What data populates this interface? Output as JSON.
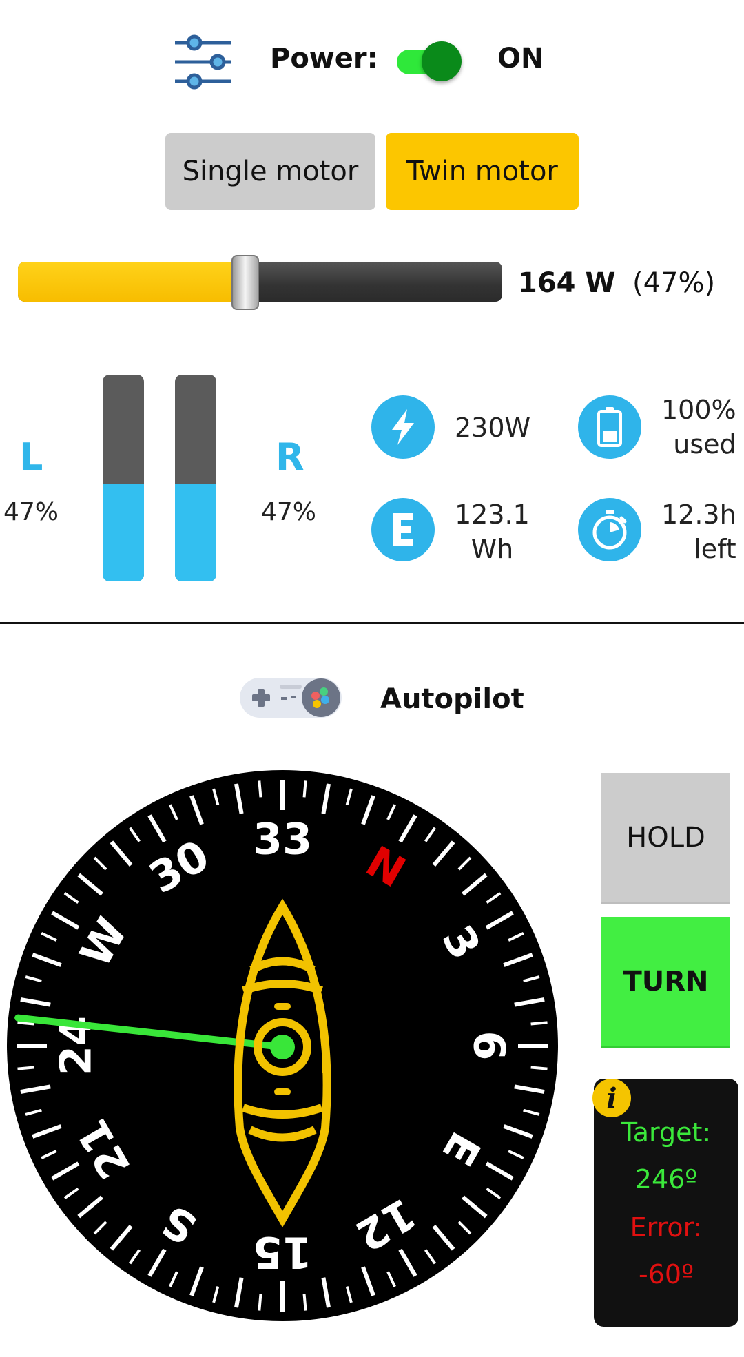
{
  "header": {
    "power_label": "Power:",
    "power_state": "ON",
    "power_on": true
  },
  "modes": {
    "single_label": "Single motor",
    "twin_label": "Twin motor",
    "selected": "Twin motor",
    "selected_color": "#fcc600"
  },
  "power_slider": {
    "level": 0.47,
    "watts_text": "164 W",
    "percent_text": "(47%)",
    "fill_color": "#f7bd00"
  },
  "motors": {
    "left_label": "L",
    "left_pct": "47%",
    "left_level": 0.47,
    "right_label": "R",
    "right_pct": "47%",
    "right_level": 0.47,
    "bar_color": "#33bff0"
  },
  "stats": {
    "power_value": "230W",
    "power_icon": "lightning-icon",
    "battery_line1": "100%",
    "battery_line2": "used",
    "battery_icon": "battery-icon",
    "energy_line1": "123.1",
    "energy_line2": "Wh",
    "energy_icon": "energy-e-icon",
    "time_line1": "12.3h",
    "time_line2": "left",
    "time_icon": "stopwatch-icon"
  },
  "autopilot": {
    "label": "Autopilot",
    "icon": "gamepad-icon"
  },
  "compass": {
    "cardinal_labels": [
      "N",
      "E",
      "S",
      "W"
    ],
    "degree_labels": [
      "3",
      "6",
      "12",
      "15",
      "21",
      "24",
      "30",
      "33"
    ],
    "rotation_deg": 30,
    "target_heading_deg": 246,
    "needle_color": "#39e639",
    "north_color": "#e00000",
    "boat_color": "#f2c200"
  },
  "buttons": {
    "hold_label": "HOLD",
    "turn_label": "TURN",
    "turn_color": "#42ee42"
  },
  "info": {
    "badge": "i",
    "target_label": "Target:",
    "target_value": "246º",
    "error_label": "Error:",
    "error_value": "-60º",
    "target_color": "#3be83b",
    "error_color": "#e01010"
  }
}
